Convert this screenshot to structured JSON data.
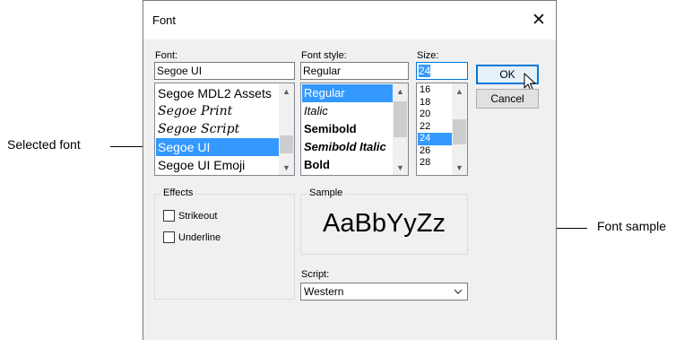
{
  "callouts": {
    "selected_font": "Selected font",
    "font_sample": "Font sample"
  },
  "dialog": {
    "title": "Font",
    "close_glyph": "✕",
    "font_label": "Font:",
    "font_value": "Segoe UI",
    "font_list": [
      "Segoe MDL2 Assets",
      "Segoe Print",
      "Segoe Script",
      "Segoe UI",
      "Segoe UI Emoji"
    ],
    "font_selected": "Segoe UI",
    "style_label": "Font style:",
    "style_value": "Regular",
    "style_list": [
      "Regular",
      "Italic",
      "Semibold",
      "Semibold Italic",
      "Bold"
    ],
    "style_selected": "Regular",
    "size_label": "Size:",
    "size_value": "24",
    "size_list": [
      "16",
      "18",
      "20",
      "22",
      "24",
      "26",
      "28"
    ],
    "size_selected": "24",
    "ok_label": "OK",
    "cancel_label": "Cancel",
    "effects_title": "Effects",
    "strikeout_label": "Strikeout",
    "underline_label": "Underline",
    "sample_title": "Sample",
    "sample_text": "AaBbYyZz",
    "script_label": "Script:",
    "script_value": "Western"
  },
  "icons": {
    "scroll_up": "▲",
    "scroll_down": "▼"
  },
  "colors": {
    "selection": "#3399ff",
    "focus": "#0078d7",
    "dialog_bg": "#f0f0f0"
  }
}
